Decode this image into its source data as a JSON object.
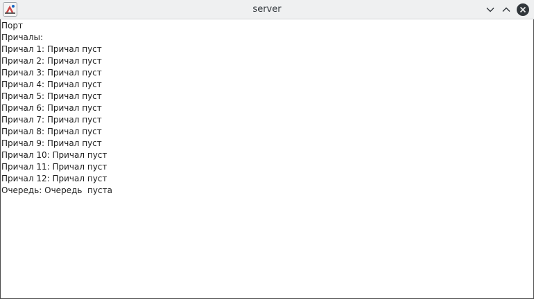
{
  "window": {
    "title": "server",
    "app_icon": "java-app-icon",
    "controls": {
      "minimize_icon": "chevron-down-icon",
      "maximize_icon": "chevron-up-icon",
      "close_icon": "close-circle-icon"
    }
  },
  "content": {
    "header": "Порт",
    "berths_label": "Причалы:",
    "berths": [
      "Причал 1: Причал пуст",
      "Причал 2: Причал пуст",
      "Причал 3: Причал пуст",
      "Причал 4: Причал пуст",
      "Причал 5: Причал пуст",
      "Причал 6: Причал пуст",
      "Причал 7: Причал пуст",
      "Причал 8: Причал пуст",
      "Причал 9: Причал пуст",
      "Причал 10: Причал пуст",
      "Причал 11: Причал пуст",
      "Причал 12: Причал пуст"
    ],
    "queue": "Очередь: Очередь  пуста"
  }
}
